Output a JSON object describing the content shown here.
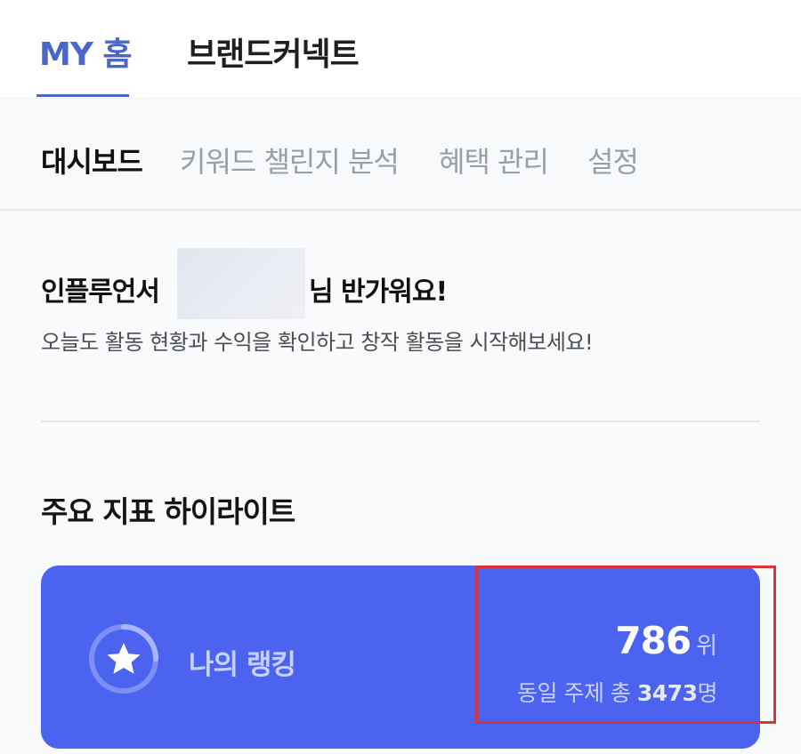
{
  "header": {
    "tabs": [
      {
        "label": "MY 홈",
        "active": true
      },
      {
        "label": "브랜드커넥트",
        "active": false
      }
    ]
  },
  "sub_nav": {
    "tabs": [
      {
        "label": "대시보드",
        "active": true
      },
      {
        "label": "키워드 챌린지 분석",
        "active": false
      },
      {
        "label": "혜택 관리",
        "active": false
      },
      {
        "label": "설정",
        "active": false
      }
    ]
  },
  "greeting": {
    "prefix": "인플루언서",
    "suffix": "님 반가워요!",
    "subtitle": "오늘도 활동 현황과 수익을 확인하고 창작 활동을 시작해보세요!"
  },
  "highlights": {
    "title": "주요 지표 하이라이트",
    "rank_card": {
      "icon": "star-icon",
      "label": "나의 랭킹",
      "rank": "786",
      "rank_unit": "위",
      "total_prefix": "동일 주제 총",
      "total_count": "3473",
      "total_suffix": "명"
    }
  },
  "colors": {
    "accent": "#4a67c7",
    "card": "#4c63ef",
    "highlight_border": "#d9323a"
  }
}
